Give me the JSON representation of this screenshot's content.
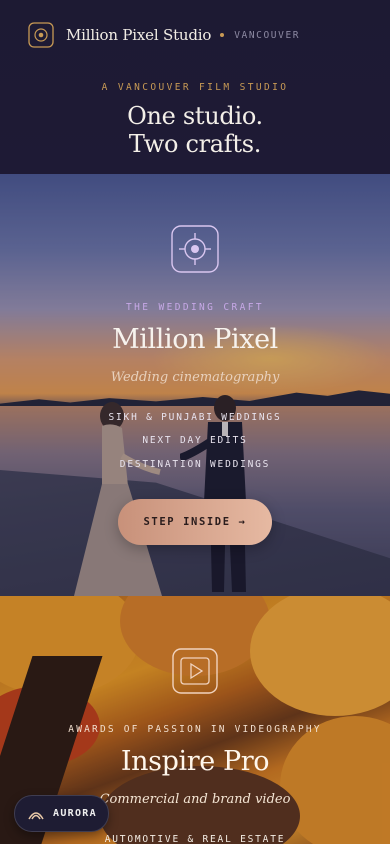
{
  "header": {
    "brand_name": "Million Pixel Studio",
    "city": "VANCOUVER",
    "eyebrow": "A VANCOUVER FILM STUDIO",
    "headline_line1": "One studio.",
    "headline_line2": "Two crafts."
  },
  "wedding": {
    "icon": "target-icon",
    "eyebrow": "THE WEDDING CRAFT",
    "title": "Million Pixel",
    "subtitle": "Wedding cinematography",
    "services": [
      "SIKH & PUNJABI WEDDINGS",
      "NEXT DAY EDITS",
      "DESTINATION WEDDINGS"
    ],
    "cta_label": "STEP INSIDE →"
  },
  "inspire": {
    "icon": "play-icon",
    "eyebrow": "AWARDS OF PASSION IN VIDEOGRAPHY",
    "title": "Inspire Pro",
    "subtitle": "Commercial and brand video",
    "services": [
      "AUTOMOTIVE & REAL ESTATE"
    ]
  },
  "aurora": {
    "label": "AURORA",
    "icon": "aurora-icon"
  },
  "colors": {
    "background": "#1d1a33",
    "accent_gold": "#c89a55",
    "cta_gradient_start": "#c8917a",
    "cta_gradient_end": "#e6b9a2",
    "wedding_eyebrow": "#c6a8e6"
  }
}
